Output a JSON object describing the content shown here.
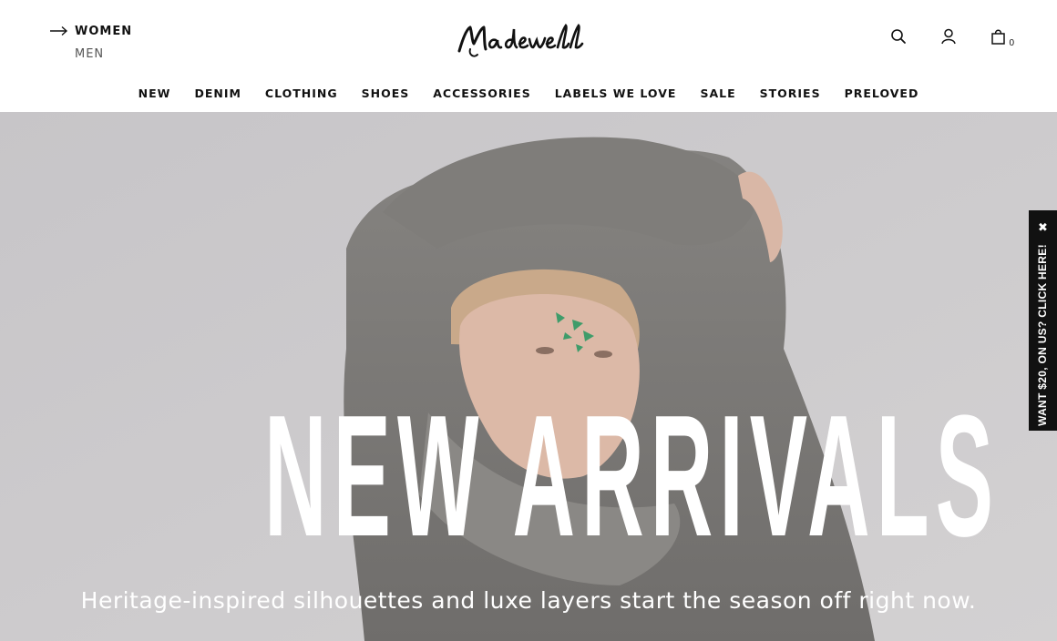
{
  "gender_switch": {
    "active": "WOMEN",
    "inactive": "MEN"
  },
  "brand": {
    "logo_text": "Madewell"
  },
  "utility": {
    "search_icon": "search-icon",
    "account_icon": "user-icon",
    "bag_icon": "shopping-bag-icon",
    "bag_count": "0"
  },
  "nav": {
    "items": [
      {
        "label": "NEW"
      },
      {
        "label": "DENIM"
      },
      {
        "label": "CLOTHING"
      },
      {
        "label": "SHOES"
      },
      {
        "label": "ACCESSORIES"
      },
      {
        "label": "LABELS WE LOVE"
      },
      {
        "label": "SALE"
      },
      {
        "label": "STORIES"
      },
      {
        "label": "PRELOVED"
      }
    ]
  },
  "hero": {
    "headline": "NEW ARRIVALS",
    "subtitle": "Heritage-inspired silhouettes and luxe layers start the season off right now."
  },
  "promo_tab": {
    "close_glyph": "✖",
    "text": "WANT $20, ON US? CLICK HERE!"
  },
  "colors": {
    "text": "#111111",
    "hero_bg": "#cbc9cb",
    "sweater": "#7b7977",
    "promo_bg": "#111111"
  }
}
